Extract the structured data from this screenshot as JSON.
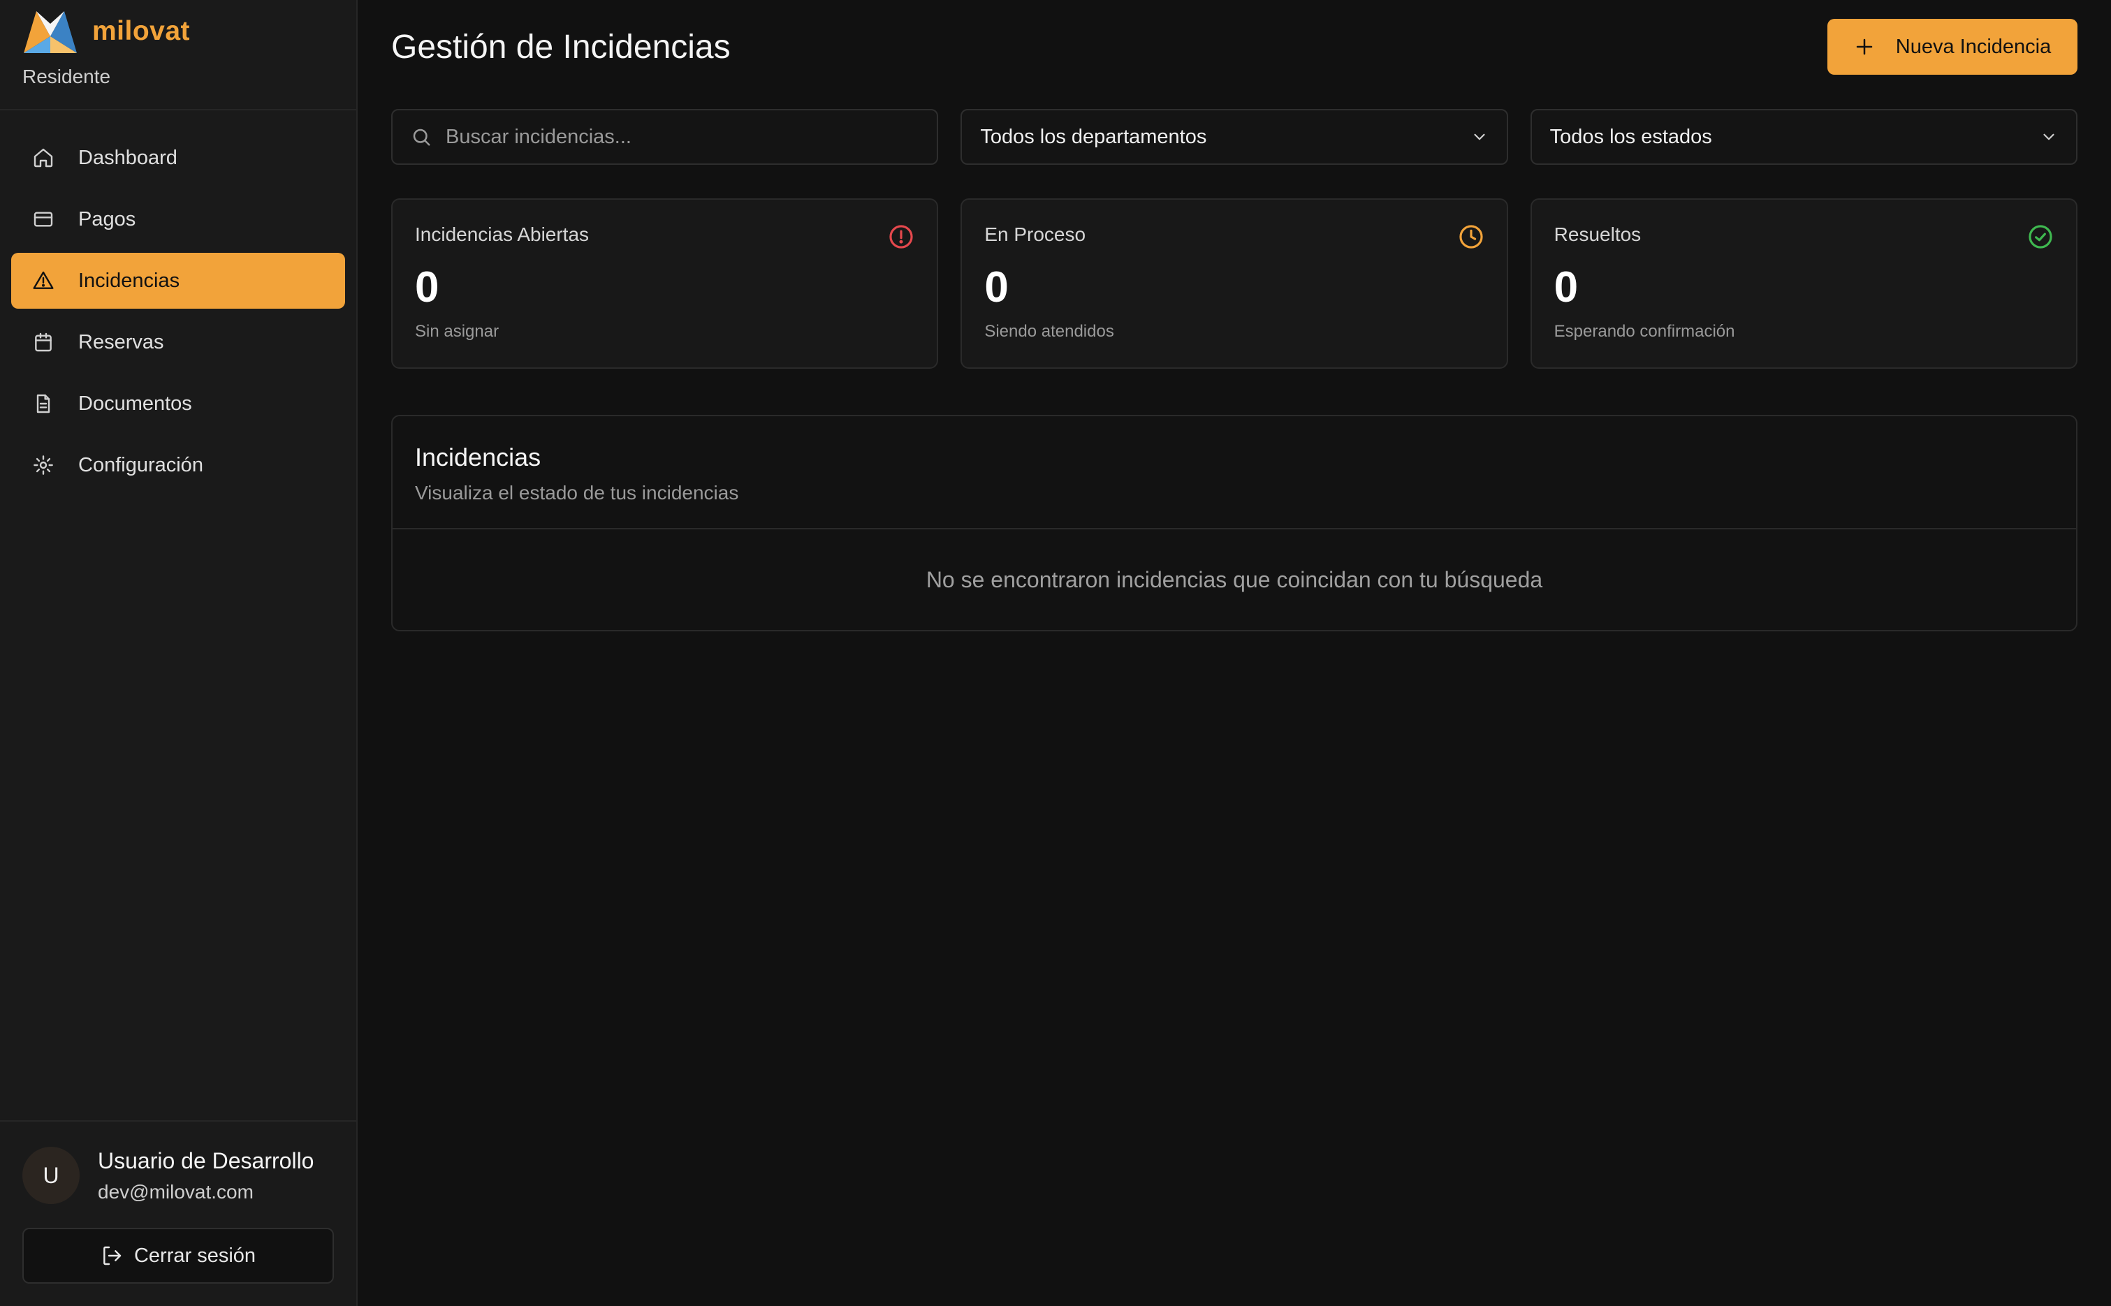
{
  "brand": {
    "name": "milovat",
    "role": "Residente",
    "accent": "#f2a33a"
  },
  "sidebar": {
    "items": [
      {
        "label": "Dashboard",
        "icon": "home-icon",
        "active": false
      },
      {
        "label": "Pagos",
        "icon": "credit-card-icon",
        "active": false
      },
      {
        "label": "Incidencias",
        "icon": "alert-triangle-icon",
        "active": true
      },
      {
        "label": "Reservas",
        "icon": "calendar-icon",
        "active": false
      },
      {
        "label": "Documentos",
        "icon": "document-icon",
        "active": false
      },
      {
        "label": "Configuración",
        "icon": "gear-icon",
        "active": false
      }
    ]
  },
  "user": {
    "initial": "U",
    "name": "Usuario de Desarrollo",
    "email": "dev@milovat.com",
    "logout_label": "Cerrar sesión"
  },
  "header": {
    "title": "Gestión de Incidencias",
    "new_button": "Nueva Incidencia"
  },
  "filters": {
    "search_placeholder": "Buscar incidencias...",
    "department": "Todos los departamentos",
    "status": "Todos los estados"
  },
  "stats": [
    {
      "title": "Incidencias Abiertas",
      "value": "0",
      "sub": "Sin asignar",
      "icon": "alert-circle-icon",
      "color": "#e5484d"
    },
    {
      "title": "En Proceso",
      "value": "0",
      "sub": "Siendo atendidos",
      "icon": "clock-icon",
      "color": "#f2a33a"
    },
    {
      "title": "Resueltos",
      "value": "0",
      "sub": "Esperando confirmación",
      "icon": "check-circle-icon",
      "color": "#3fb950"
    }
  ],
  "panel": {
    "title": "Incidencias",
    "subtitle": "Visualiza el estado de tus incidencias",
    "empty_message": "No se encontraron incidencias que coincidan con tu búsqueda"
  }
}
